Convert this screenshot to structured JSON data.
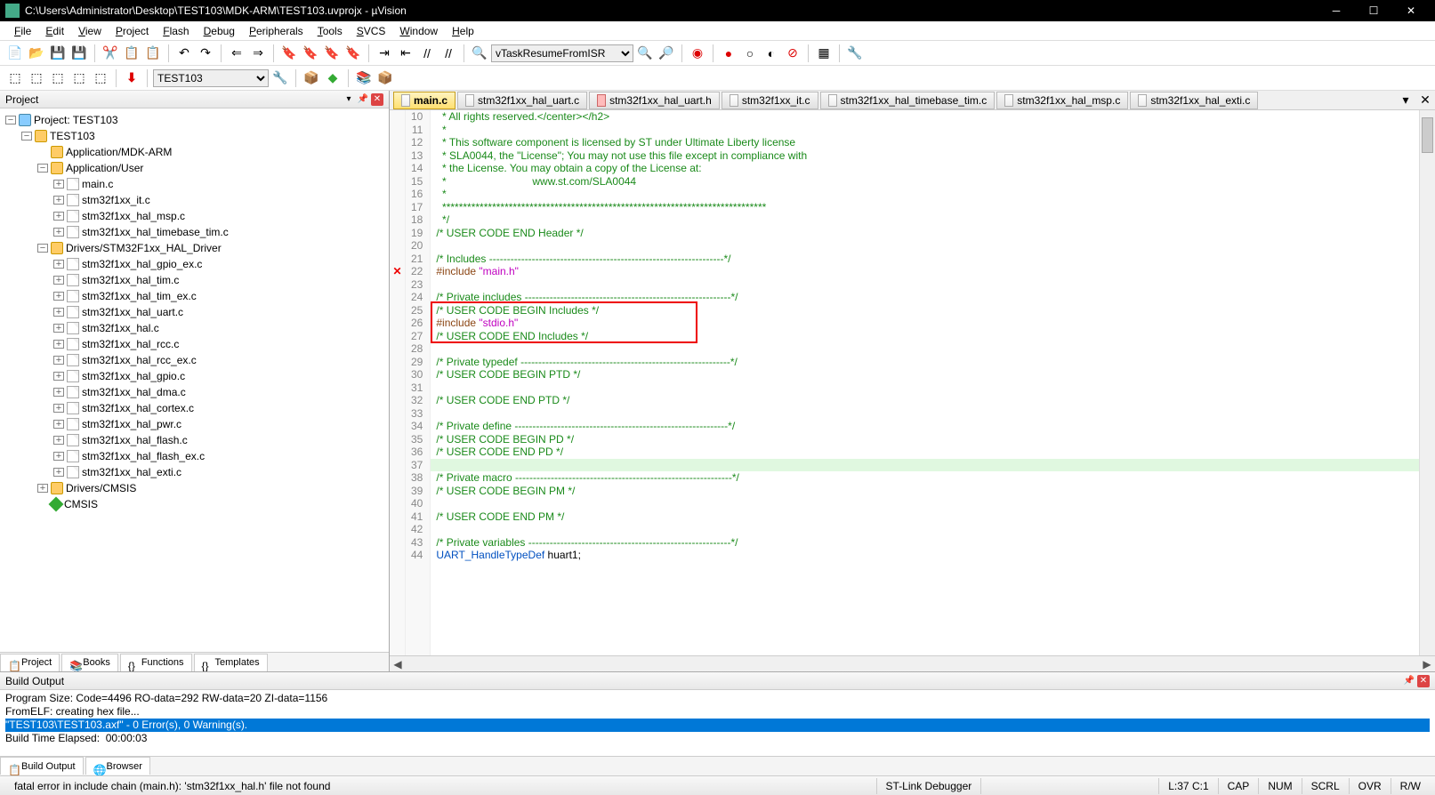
{
  "title": "C:\\Users\\Administrator\\Desktop\\TEST103\\MDK-ARM\\TEST103.uvprojx - µVision",
  "menu": [
    "File",
    "Edit",
    "View",
    "Project",
    "Flash",
    "Debug",
    "Peripherals",
    "Tools",
    "SVCS",
    "Window",
    "Help"
  ],
  "toolbar2_dropdown": "vTaskResumeFromISR",
  "target_dropdown": "TEST103",
  "project_panel": {
    "title": "Project",
    "tabs": [
      "Project",
      "Books",
      "Functions",
      "Templates"
    ]
  },
  "tree": {
    "root": "Project: TEST103",
    "target": "TEST103",
    "groups": [
      {
        "name": "Application/MDK-ARM",
        "files": []
      },
      {
        "name": "Application/User",
        "files": [
          "main.c",
          "stm32f1xx_it.c",
          "stm32f1xx_hal_msp.c",
          "stm32f1xx_hal_timebase_tim.c"
        ]
      },
      {
        "name": "Drivers/STM32F1xx_HAL_Driver",
        "files": [
          "stm32f1xx_hal_gpio_ex.c",
          "stm32f1xx_hal_tim.c",
          "stm32f1xx_hal_tim_ex.c",
          "stm32f1xx_hal_uart.c",
          "stm32f1xx_hal.c",
          "stm32f1xx_hal_rcc.c",
          "stm32f1xx_hal_rcc_ex.c",
          "stm32f1xx_hal_gpio.c",
          "stm32f1xx_hal_dma.c",
          "stm32f1xx_hal_cortex.c",
          "stm32f1xx_hal_pwr.c",
          "stm32f1xx_hal_flash.c",
          "stm32f1xx_hal_flash_ex.c",
          "stm32f1xx_hal_exti.c"
        ]
      },
      {
        "name": "Drivers/CMSIS",
        "files": []
      },
      {
        "name": "CMSIS",
        "files": [],
        "icon": "diamond"
      }
    ]
  },
  "editor_tabs": [
    {
      "name": "main.c",
      "type": "c",
      "active": true
    },
    {
      "name": "stm32f1xx_hal_uart.c",
      "type": "c"
    },
    {
      "name": "stm32f1xx_hal_uart.h",
      "type": "h"
    },
    {
      "name": "stm32f1xx_it.c",
      "type": "c"
    },
    {
      "name": "stm32f1xx_hal_timebase_tim.c",
      "type": "c"
    },
    {
      "name": "stm32f1xx_hal_msp.c",
      "type": "c"
    },
    {
      "name": "stm32f1xx_hal_exti.c",
      "type": "c"
    }
  ],
  "code": {
    "first_line": 10,
    "error_line": 22,
    "highlight_line": 37,
    "lines": [
      {
        "n": 10,
        "s": [
          "  ",
          "cmt",
          "* All rights reserved.</center></h2>"
        ]
      },
      {
        "n": 11,
        "s": [
          "  ",
          "cmt",
          "*"
        ]
      },
      {
        "n": 12,
        "s": [
          "  ",
          "cmt",
          "* This software component is licensed by ST under Ultimate Liberty license"
        ]
      },
      {
        "n": 13,
        "s": [
          "  ",
          "cmt",
          "* SLA0044, the \"License\"; You may not use this file except in compliance with"
        ]
      },
      {
        "n": 14,
        "s": [
          "  ",
          "cmt",
          "* the License. You may obtain a copy of the License at:"
        ]
      },
      {
        "n": 15,
        "s": [
          "  ",
          "cmt",
          "*                             www.st.com/SLA0044"
        ]
      },
      {
        "n": 16,
        "s": [
          "  ",
          "cmt",
          "*"
        ]
      },
      {
        "n": 17,
        "s": [
          "  ",
          "cmt",
          "******************************************************************************"
        ]
      },
      {
        "n": 18,
        "s": [
          "  ",
          "cmt",
          "*/"
        ]
      },
      {
        "n": 19,
        "s": [
          "",
          "cmt",
          "/* USER CODE END Header */"
        ]
      },
      {
        "n": 20,
        "s": [
          "",
          "",
          ""
        ]
      },
      {
        "n": 21,
        "s": [
          "",
          "cmt",
          "/* Includes ------------------------------------------------------------------*/"
        ]
      },
      {
        "n": 22,
        "s": [
          "",
          "pp",
          "#include ",
          "str",
          "\"main.h\""
        ]
      },
      {
        "n": 23,
        "s": [
          "",
          "",
          ""
        ]
      },
      {
        "n": 24,
        "s": [
          "",
          "cmt",
          "/* Private includes ----------------------------------------------------------*/"
        ]
      },
      {
        "n": 25,
        "s": [
          "",
          "cmt",
          "/* USER CODE BEGIN Includes */"
        ]
      },
      {
        "n": 26,
        "s": [
          "",
          "pp",
          "#include ",
          "str",
          "\"stdio.h\""
        ]
      },
      {
        "n": 27,
        "s": [
          "",
          "cmt",
          "/* USER CODE END Includes */"
        ]
      },
      {
        "n": 28,
        "s": [
          "",
          "",
          ""
        ]
      },
      {
        "n": 29,
        "s": [
          "",
          "cmt",
          "/* Private typedef -----------------------------------------------------------*/"
        ]
      },
      {
        "n": 30,
        "s": [
          "",
          "cmt",
          "/* USER CODE BEGIN PTD */"
        ]
      },
      {
        "n": 31,
        "s": [
          "",
          "",
          ""
        ]
      },
      {
        "n": 32,
        "s": [
          "",
          "cmt",
          "/* USER CODE END PTD */"
        ]
      },
      {
        "n": 33,
        "s": [
          "",
          "",
          ""
        ]
      },
      {
        "n": 34,
        "s": [
          "",
          "cmt",
          "/* Private define ------------------------------------------------------------*/"
        ]
      },
      {
        "n": 35,
        "s": [
          "",
          "cmt",
          "/* USER CODE BEGIN PD */"
        ]
      },
      {
        "n": 36,
        "s": [
          "",
          "cmt",
          "/* USER CODE END PD */"
        ]
      },
      {
        "n": 37,
        "s": [
          "",
          "",
          ""
        ]
      },
      {
        "n": 38,
        "s": [
          "",
          "cmt",
          "/* Private macro -------------------------------------------------------------*/"
        ]
      },
      {
        "n": 39,
        "s": [
          "",
          "cmt",
          "/* USER CODE BEGIN PM */"
        ]
      },
      {
        "n": 40,
        "s": [
          "",
          "",
          ""
        ]
      },
      {
        "n": 41,
        "s": [
          "",
          "cmt",
          "/* USER CODE END PM */"
        ]
      },
      {
        "n": 42,
        "s": [
          "",
          "",
          ""
        ]
      },
      {
        "n": 43,
        "s": [
          "",
          "cmt",
          "/* Private variables ---------------------------------------------------------*/"
        ]
      },
      {
        "n": 44,
        "s": [
          "",
          "typ",
          "UART_HandleTypeDef ",
          "",
          "huart1;"
        ]
      }
    ],
    "redbox": {
      "from": 25,
      "to": 27
    }
  },
  "build": {
    "title": "Build Output",
    "lines": [
      {
        "t": "Program Size: Code=4496 RO-data=292 RW-data=20 ZI-data=1156",
        "sel": false
      },
      {
        "t": "FromELF: creating hex file...",
        "sel": false
      },
      {
        "t": "\"TEST103\\TEST103.axf\" - 0 Error(s), 0 Warning(s).",
        "sel": true
      },
      {
        "t": "Build Time Elapsed:  00:00:03",
        "sel": false
      }
    ],
    "tabs": [
      "Build Output",
      "Browser"
    ]
  },
  "status": {
    "msg": "fatal error in include chain (main.h): 'stm32f1xx_hal.h' file not found",
    "debugger": "ST-Link Debugger",
    "pos": "L:37 C:1",
    "ind": [
      "CAP",
      "NUM",
      "SCRL",
      "OVR",
      "R/W"
    ]
  }
}
